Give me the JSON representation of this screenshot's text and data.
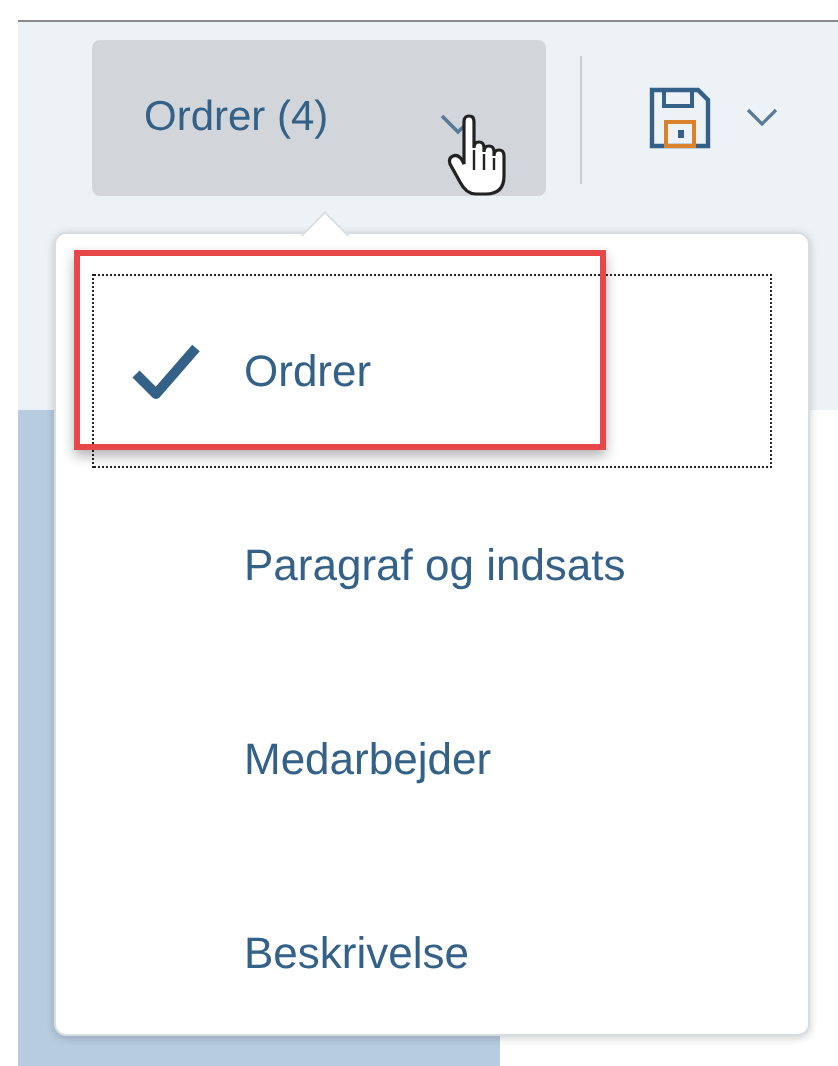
{
  "toolbar": {
    "view_button": {
      "label": "Ordrer (4)",
      "open": true
    },
    "save_button": {
      "has_dropdown": true
    }
  },
  "menu": {
    "items": [
      {
        "label": "Ordrer",
        "selected": true,
        "focused": true,
        "highlighted": true
      },
      {
        "label": "Paragraf og indsats",
        "selected": false,
        "focused": false,
        "highlighted": false
      },
      {
        "label": "Medarbejder",
        "selected": false,
        "focused": false,
        "highlighted": false
      },
      {
        "label": "Beskrivelse",
        "selected": false,
        "focused": false,
        "highlighted": false
      }
    ]
  }
}
